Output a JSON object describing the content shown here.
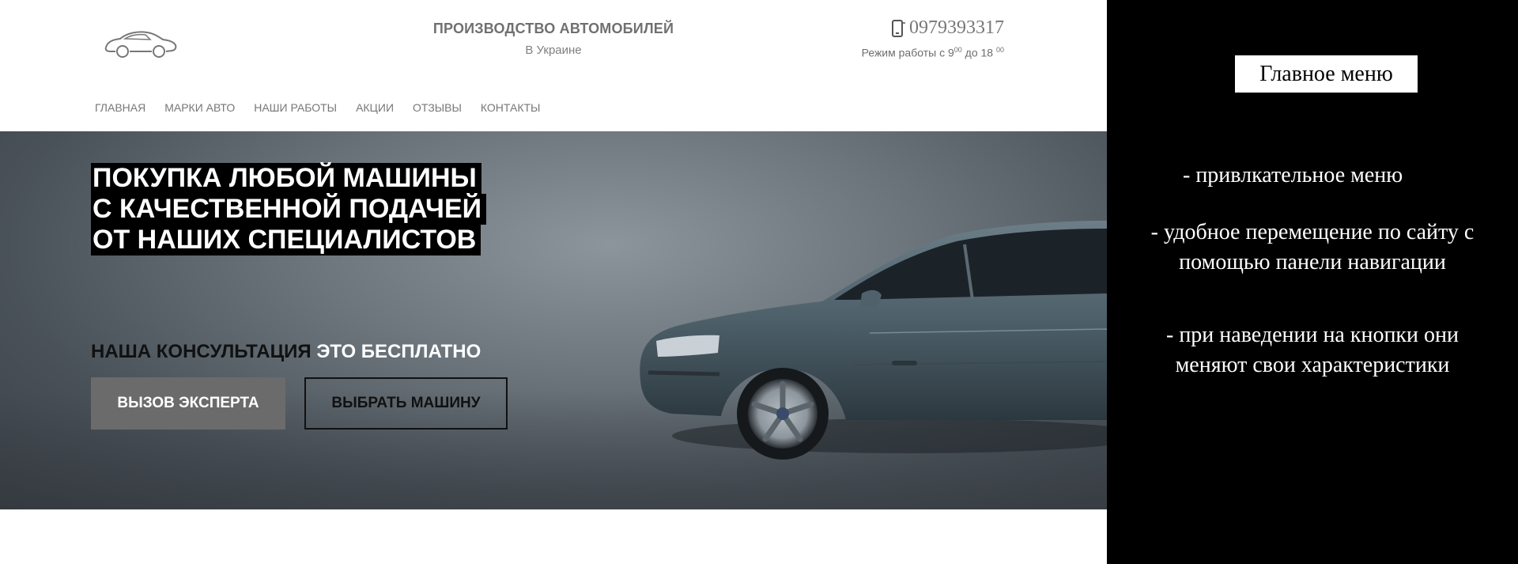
{
  "header": {
    "brand_title": "ПРОИЗВОДСТВО АВТОМОБИЛЕЙ",
    "brand_subtitle": "В Украине",
    "phone": "0979393317",
    "hours": {
      "prefix": "Режим работы с 9",
      "sup1": "00",
      "middle": " до 18 ",
      "sup2": "00"
    }
  },
  "nav": {
    "items": [
      {
        "label": "ГЛАВНАЯ"
      },
      {
        "label": "МАРКИ АВТО"
      },
      {
        "label": "НАШИ РАБОТЫ"
      },
      {
        "label": "АКЦИИ"
      },
      {
        "label": "ОТЗЫВЫ"
      },
      {
        "label": "КОНТАКТЫ"
      }
    ]
  },
  "hero": {
    "title_lines": [
      "ПОКУПКА ЛЮБОЙ МАШИНЫ",
      "С КАЧЕСТВЕННОЙ ПОДАЧЕЙ",
      "ОТ НАШИХ СПЕЦИАЛИСТОВ"
    ],
    "consult_dark": "НАША КОНСУЛЬТАЦИЯ",
    "consult_light": "ЭТО БЕСПЛАТНО",
    "btn_expert": "ВЫЗОВ ЭКСПЕРТА",
    "btn_choose": "ВЫБРАТЬ МАШИНУ"
  },
  "panel": {
    "title": "Главное меню",
    "points": [
      "- привлкательное меню",
      "- удобное перемещение по сайту с помощью панели навигации",
      "- при наведении на кнопки они меняют свои характеристики"
    ]
  },
  "icons": {
    "logo": "car-logo-icon",
    "phone": "phone-icon"
  },
  "colors": {
    "panel_bg": "#000000",
    "btn_expert_bg": "#6b6b6b",
    "nav_text": "#777777"
  }
}
